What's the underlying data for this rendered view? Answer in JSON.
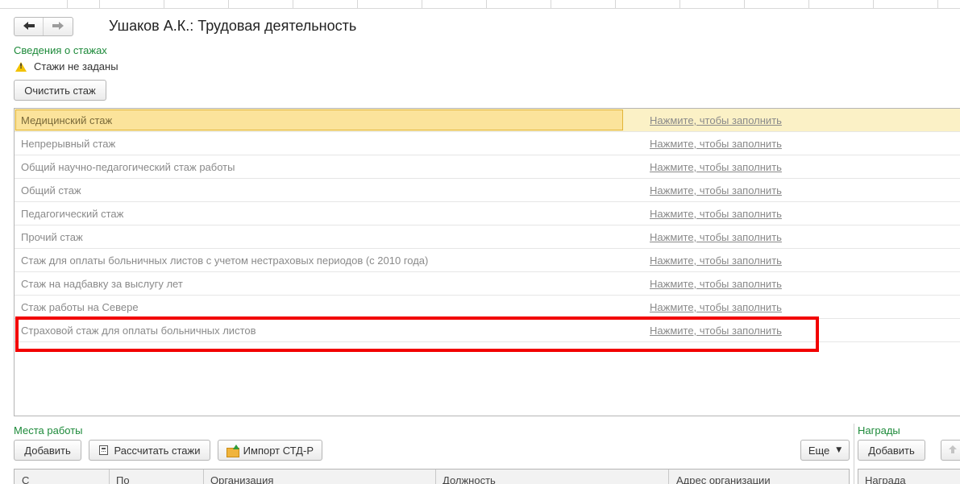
{
  "nav": {
    "back_glyph": "🡐",
    "forward_glyph": "🡒"
  },
  "header": {
    "title": "Ушаков А.К.: Трудовая деятельность"
  },
  "experience": {
    "section_label": "Сведения о стажах",
    "warning_text": "Стажи не заданы",
    "clear_button": "Очистить стаж",
    "rows": [
      {
        "name": "Медицинский стаж",
        "action": "Нажмите, чтобы заполнить"
      },
      {
        "name": "Непрерывный стаж",
        "action": "Нажмите, чтобы заполнить"
      },
      {
        "name": "Общий научно-педагогический стаж работы",
        "action": "Нажмите, чтобы заполнить"
      },
      {
        "name": "Общий стаж",
        "action": "Нажмите, чтобы заполнить"
      },
      {
        "name": "Педагогический стаж",
        "action": "Нажмите, чтобы заполнить"
      },
      {
        "name": "Прочий стаж",
        "action": "Нажмите, чтобы заполнить"
      },
      {
        "name": "Стаж для оплаты больничных листов с учетом нестраховых периодов (с 2010 года)",
        "action": "Нажмите, чтобы заполнить"
      },
      {
        "name": "Стаж на надбавку за выслугу лет",
        "action": "Нажмите, чтобы заполнить"
      },
      {
        "name": "Стаж работы на Севере",
        "action": "Нажмите, чтобы заполнить"
      },
      {
        "name": "Страховой стаж для оплаты больничных листов",
        "action": "Нажмите, чтобы заполнить"
      }
    ]
  },
  "workplaces": {
    "section_label": "Места работы",
    "add_button": "Добавить",
    "calc_button": "Рассчитать стажи",
    "import_button": "Импорт СТД-Р",
    "more_button": "Еще",
    "columns": [
      "С",
      "По",
      "Организация",
      "Должность",
      "Адрес организации"
    ]
  },
  "awards": {
    "section_label": "Награды",
    "add_button": "Добавить",
    "columns": [
      "Награда"
    ]
  },
  "colors": {
    "accent_green": "#1d8a3a",
    "highlight_red": "#f20000",
    "selected_row": "#fbf1c6"
  }
}
